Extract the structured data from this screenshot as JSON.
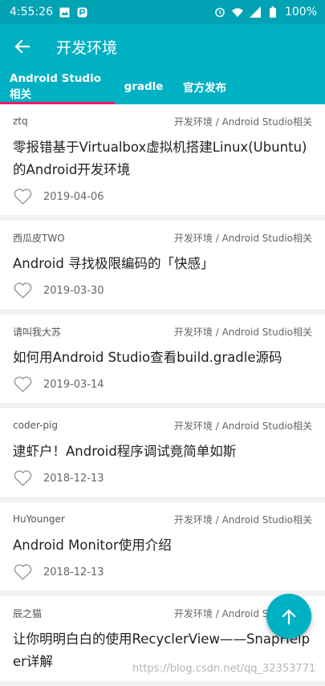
{
  "status_bar": {
    "time": "4:55:26",
    "battery": "100%"
  },
  "app_bar": {
    "title": "开发环境"
  },
  "tabs": [
    {
      "label": "Android Studio相关"
    },
    {
      "label": "gradle"
    },
    {
      "label": "官方发布"
    }
  ],
  "articles": [
    {
      "author": "ztq",
      "category": "开发环境 / Android Studio相关",
      "title": "零报错基于Virtualbox虚拟机搭建Linux(Ubuntu)的Android开发环境",
      "date": "2019-04-06"
    },
    {
      "author": "西瓜皮TWO",
      "category": "开发环境 / Android Studio相关",
      "title": "Android 寻找极限编码的「快感」",
      "date": "2019-03-30"
    },
    {
      "author": "请叫我大苏",
      "category": "开发环境 / Android Studio相关",
      "title": "如何用Android Studio查看build.gradle源码",
      "date": "2019-03-14"
    },
    {
      "author": "coder-pig",
      "category": "开发环境 / Android Studio相关",
      "title": "逮虾户！Android程序调试竟简单如斯",
      "date": "2018-12-13"
    },
    {
      "author": "HuYounger",
      "category": "开发环境 / Android Studio相关",
      "title": "Android Monitor使用介绍",
      "date": "2018-12-13"
    },
    {
      "author": "辰之猫",
      "category": "开发环境 / Android Studio相关",
      "title": "让你明明白白的使用RecyclerView——SnapHelper详解",
      "date": ""
    }
  ],
  "watermark": "https://blog.csdn.net/qq_32353771",
  "colors": {
    "primary": "#00b1c3",
    "status_bar": "#00a2b4",
    "tab_indicator": "#e91e63"
  },
  "icons": {
    "back": "arrow-left-icon",
    "like": "heart-outline-icon",
    "fab": "arrow-up-icon"
  }
}
